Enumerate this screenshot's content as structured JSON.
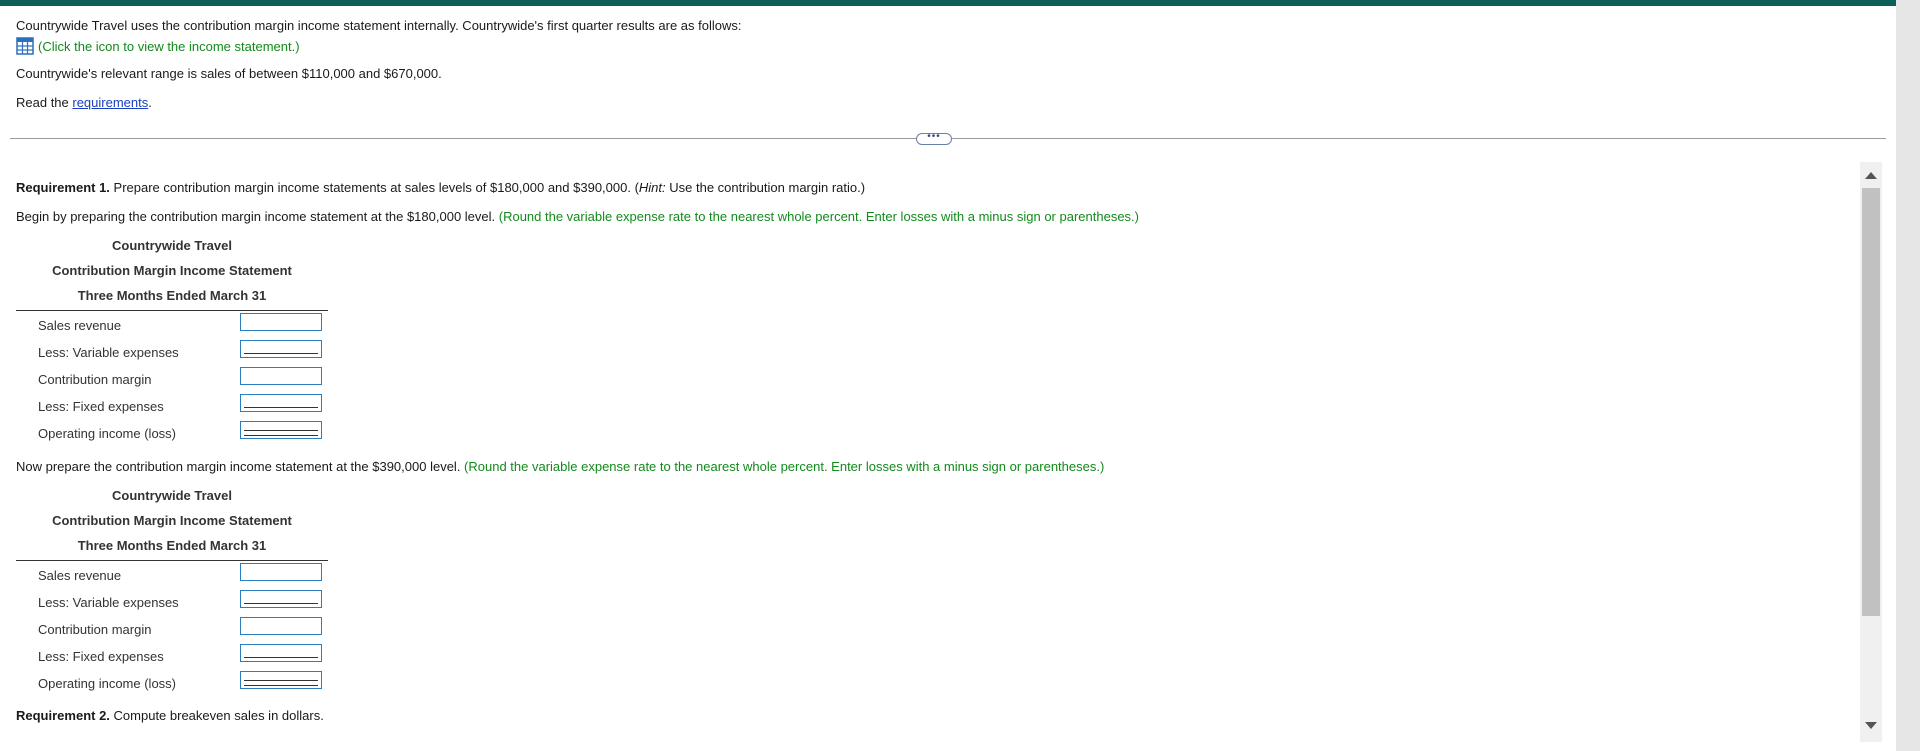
{
  "problem": {
    "intro": "Countrywide Travel uses the contribution margin income statement internally. Countrywide's first quarter results are as follows:",
    "icon_prompt": "(Click the icon to view the income statement.)",
    "range_text": "Countrywide's relevant range is sales of between $110,000 and $670,000.",
    "read_prefix": "Read the ",
    "requirements_link": "requirements",
    "read_suffix": "."
  },
  "divider": {
    "handle": "•••"
  },
  "requirement1": {
    "label": "Requirement 1.",
    "text_a": " Prepare contribution margin income statements at sales levels of $180,000 and $390,000. (",
    "hint": "Hint:",
    "text_b": " Use the contribution margin ratio.)",
    "begin_text": "Begin by preparing the contribution margin income statement at the $180,000 level. ",
    "instruction": "(Round the variable expense rate to the nearest whole percent. Enter losses with a minus sign or parentheses.)",
    "now_text": "Now prepare the contribution margin income statement at the $390,000 level. "
  },
  "statement": {
    "company": "Countrywide Travel",
    "title": "Contribution Margin Income Statement",
    "period": "Three Months Ended March 31",
    "rows": [
      {
        "label": "Sales revenue",
        "value": ""
      },
      {
        "label": "Less: Variable expenses",
        "value": ""
      },
      {
        "label": "Contribution margin",
        "value": ""
      },
      {
        "label": "Less: Fixed expenses",
        "value": ""
      },
      {
        "label": "Operating income (loss)",
        "value": ""
      }
    ]
  },
  "requirement2": {
    "label": "Requirement 2.",
    "text": " Compute breakeven sales in dollars."
  },
  "colors": {
    "header_bar": "#0d6058",
    "instruction_green": "#138a1c",
    "link_blue": "#1a3fbf",
    "field_border": "#2a7ec0"
  },
  "icons": {
    "statement_icon": "table-grid-icon"
  }
}
